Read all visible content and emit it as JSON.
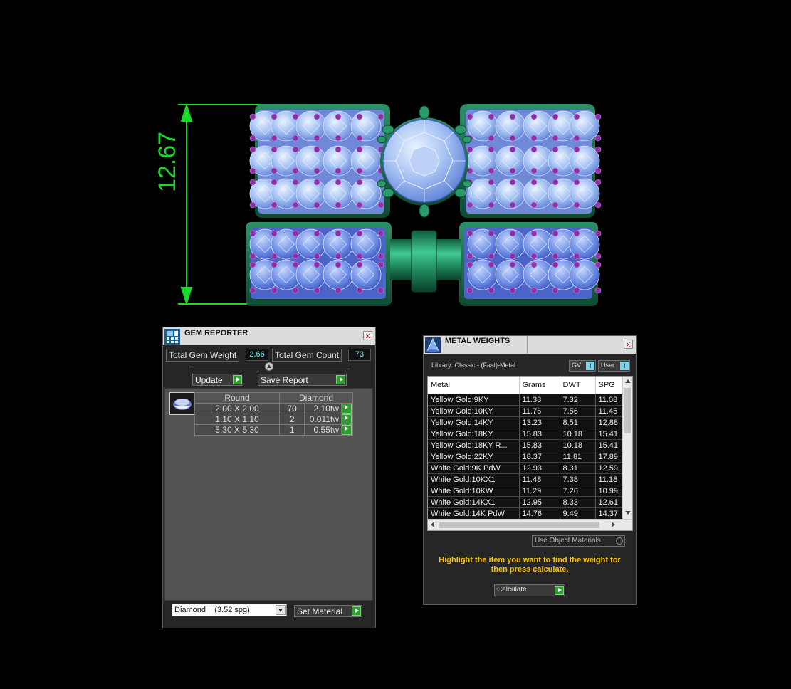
{
  "dimension": {
    "value": "12.67",
    "color": "#19d92b"
  },
  "gem_reporter": {
    "title": "GEM REPORTER",
    "close": "x",
    "total_gem_weight_label": "Total Gem Weight",
    "total_gem_weight": "2.66",
    "total_gem_count_label": "Total Gem Count",
    "total_gem_count": "73",
    "update_label": "Update",
    "save_report_label": "Save Report",
    "headers": [
      "Round",
      "Diamond"
    ],
    "rows": [
      {
        "size": "2.00 X 2.00",
        "count": "70",
        "weight": "2.10tw"
      },
      {
        "size": "1.10 X 1.10",
        "count": "2",
        "weight": "0.011tw"
      },
      {
        "size": "5.30 X 5.30",
        "count": "1",
        "weight": "0.55tw"
      }
    ],
    "material_select": "Diamond    (3.52 spg)",
    "set_material_label": "Set Material"
  },
  "metal_weights": {
    "title": "METAL WEIGHTS",
    "close": "x",
    "library_label": "Library: Classic - (Fast)-Metal",
    "gv_label": "GV",
    "user_label": "User",
    "columns": [
      "Metal",
      "Grams",
      "DWT",
      "SPG"
    ],
    "rows": [
      [
        "Yellow Gold:9KY",
        "11.38",
        "7.32",
        "11.08"
      ],
      [
        "Yellow Gold:10KY",
        "11.76",
        "7.56",
        "11.45"
      ],
      [
        "Yellow Gold:14KY",
        "13.23",
        "8.51",
        "12.88"
      ],
      [
        "Yellow Gold:18KY",
        "15.83",
        "10.18",
        "15.41"
      ],
      [
        "Yellow Gold:18KY R...",
        "15.83",
        "10.18",
        "15.41"
      ],
      [
        "Yellow Gold:22KY",
        "18.37",
        "11.81",
        "17.89"
      ],
      [
        "White Gold:9K PdW",
        "12.93",
        "8.31",
        "12.59"
      ],
      [
        "White Gold:10KX1",
        "11.48",
        "7.38",
        "11.18"
      ],
      [
        "White Gold:10KW",
        "11.29",
        "7.26",
        "10.99"
      ],
      [
        "White Gold:14KX1",
        "12.95",
        "8.33",
        "12.61"
      ],
      [
        "White Gold:14K PdW",
        "14.76",
        "9.49",
        "14.37"
      ]
    ],
    "use_object_materials_label": "Use Object Materials",
    "hint": "Highlight the item you want to find the weight for then press calculate.",
    "calculate_label": "Calculate"
  }
}
